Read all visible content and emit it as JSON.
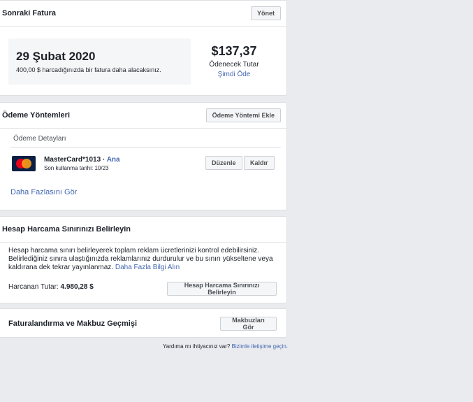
{
  "next_bill": {
    "title": "Sonraki Fatura",
    "manage_label": "Yönet",
    "date": "29 Şubat 2020",
    "description": "400,00 $ harcadığınızda bir fatura daha alacaksınız.",
    "amount": "$137,37",
    "amount_label": "Ödenecek Tutar",
    "pay_now_label": "Şimdi Öde"
  },
  "payment_methods": {
    "title": "Ödeme Yöntemleri",
    "add_label": "Ödeme Yöntemi Ekle",
    "details_title": "Ödeme Detayları",
    "card": {
      "icon": "mastercard-icon",
      "name": "MasterCard*1013",
      "separator": " · ",
      "primary_label": "Ana",
      "expiry": "Son kullanma tarihi: 10/23",
      "edit_label": "Düzenle",
      "remove_label": "Kaldır"
    },
    "see_more_label": "Daha Fazlasını Gör"
  },
  "spending_limit": {
    "title": "Hesap Harcama Sınırınızı Belirleyin",
    "description": "Hesap harcama sınırı belirleyerek toplam reklam ücretlerinizi kontrol edebilirsiniz. Belirlediğiniz sınıra ulaştığınızda reklamlarınız durdurulur ve bu sınırı yükseltene veya kaldırana dek tekrar yayınlanmaz.",
    "learn_more_label": "Daha Fazla Bilgi Alın",
    "spent_label": "Harcanan Tutar:",
    "spent_value": "4.980,28 $",
    "button_label": "Hesap Harcama Sınırınızı Belirleyin"
  },
  "billing_history": {
    "title": "Faturalandırma ve Makbuz Geçmişi",
    "receipts_label": "Makbuzları Gör"
  },
  "footer": {
    "help_text": "Yardıma mı ihtiyacınız var?",
    "contact_label": "Bizimle iletişime geçin."
  },
  "colors": {
    "background": "#e9ebee",
    "link": "#4267b2",
    "mastercard_red": "#eb001b",
    "mastercard_orange": "#f79e1b"
  }
}
